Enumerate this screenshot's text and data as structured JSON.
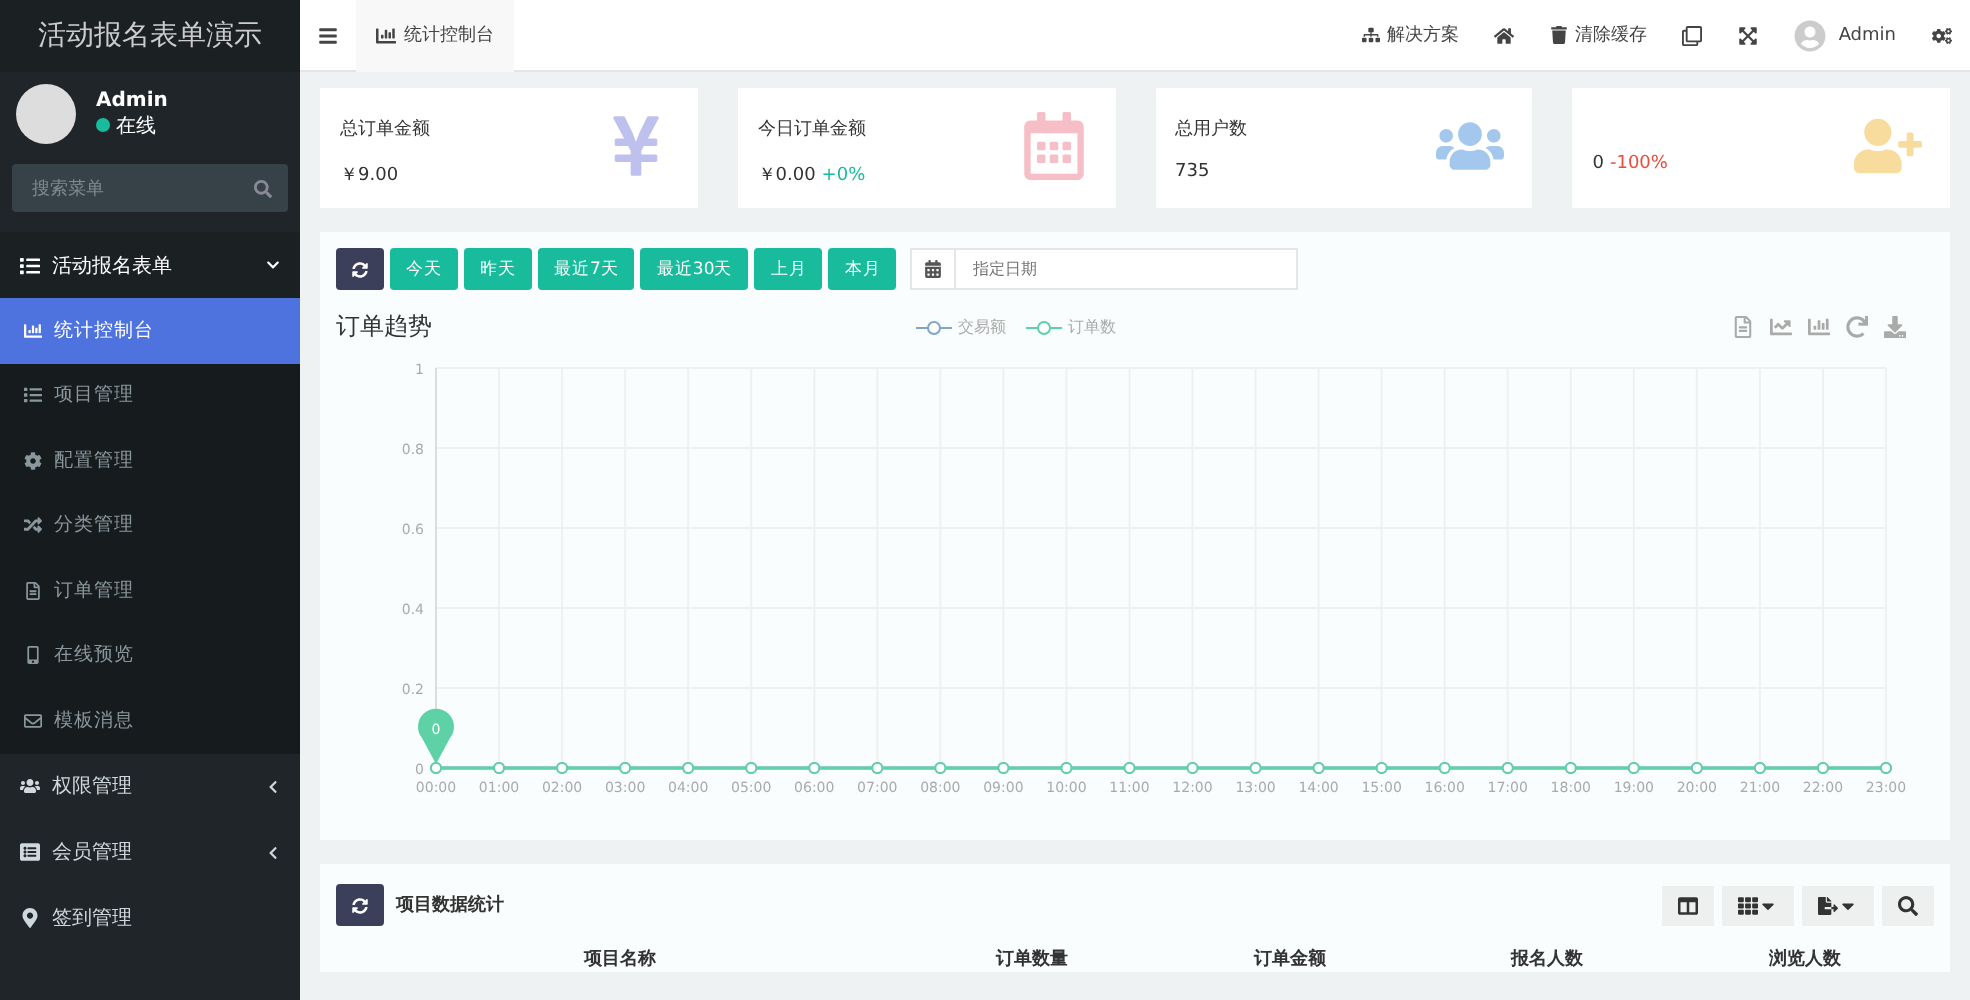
{
  "sidebar": {
    "brand": "活动报名表单演示",
    "user": {
      "name": "Admin",
      "status": "在线"
    },
    "search": {
      "placeholder": "搜索菜单"
    },
    "items": [
      {
        "label": "活动报名表单",
        "expanded": true,
        "children": [
          {
            "label": "统计控制台",
            "selected": true
          },
          {
            "label": "项目管理",
            "selected": false
          },
          {
            "label": "配置管理",
            "selected": false
          },
          {
            "label": "分类管理",
            "selected": false
          },
          {
            "label": "订单管理",
            "selected": false
          },
          {
            "label": "在线预览",
            "selected": false
          },
          {
            "label": "模板消息",
            "selected": false
          }
        ]
      },
      {
        "label": "权限管理",
        "expanded": false
      },
      {
        "label": "会员管理",
        "expanded": false
      },
      {
        "label": "签到管理"
      }
    ]
  },
  "topbar": {
    "tab": "统计控制台",
    "links": [
      {
        "kind": "text",
        "label": "解决方案"
      },
      {
        "kind": "icon"
      },
      {
        "kind": "text",
        "label": "清除缓存"
      },
      {
        "kind": "icon"
      },
      {
        "kind": "icon"
      },
      {
        "kind": "user",
        "label": "Admin"
      },
      {
        "kind": "icon"
      }
    ]
  },
  "stats": [
    {
      "title": "总订单金额",
      "value": "￥9.00"
    },
    {
      "title": "今日订单金额",
      "value": "￥0.00",
      "change": "+0%",
      "color": "#18bc9c"
    },
    {
      "title": "总用户数",
      "value": "735"
    },
    {
      "value": "0",
      "change": "-100%",
      "color": "#e74c3c"
    }
  ],
  "filters": {
    "buttons": [
      "今天",
      "昨天",
      "最近7天",
      "最近30天",
      "上月",
      "本月"
    ],
    "date": {
      "placeholder": "指定日期"
    }
  },
  "chart": {
    "title": "订单趋势",
    "chart_data": {
      "type": "line",
      "grid": true,
      "annotations": [
        "0"
      ],
      "categories": [
        "00:00",
        "01:00",
        "02:00",
        "03:00",
        "04:00",
        "05:00",
        "06:00",
        "07:00",
        "08:00",
        "09:00",
        "10:00",
        "11:00",
        "12:00",
        "13:00",
        "14:00",
        "15:00",
        "16:00",
        "17:00",
        "18:00",
        "19:00",
        "20:00",
        "21:00",
        "22:00",
        "23:00"
      ],
      "ylim": [
        0,
        1
      ],
      "yticks": [
        0,
        0.2,
        0.4,
        0.6,
        0.8,
        1
      ],
      "series": [
        {
          "name": "交易额",
          "color": "#7fa6c9",
          "marker": "circle",
          "values": [
            0,
            0,
            0,
            0,
            0,
            0,
            0,
            0,
            0,
            0,
            0,
            0,
            0,
            0,
            0,
            0,
            0,
            0,
            0,
            0,
            0,
            0,
            0,
            0
          ]
        },
        {
          "name": "订单数",
          "color": "#5fd1a7",
          "marker": "circle",
          "values": [
            0,
            0,
            0,
            0,
            0,
            0,
            0,
            0,
            0,
            0,
            0,
            0,
            0,
            0,
            0,
            0,
            0,
            0,
            0,
            0,
            0,
            0,
            0,
            0
          ]
        }
      ]
    }
  },
  "table": {
    "title": "项目数据统计",
    "columns": [
      "项目名称",
      "订单数量",
      "订单金额",
      "报名人数",
      "浏览人数"
    ]
  }
}
